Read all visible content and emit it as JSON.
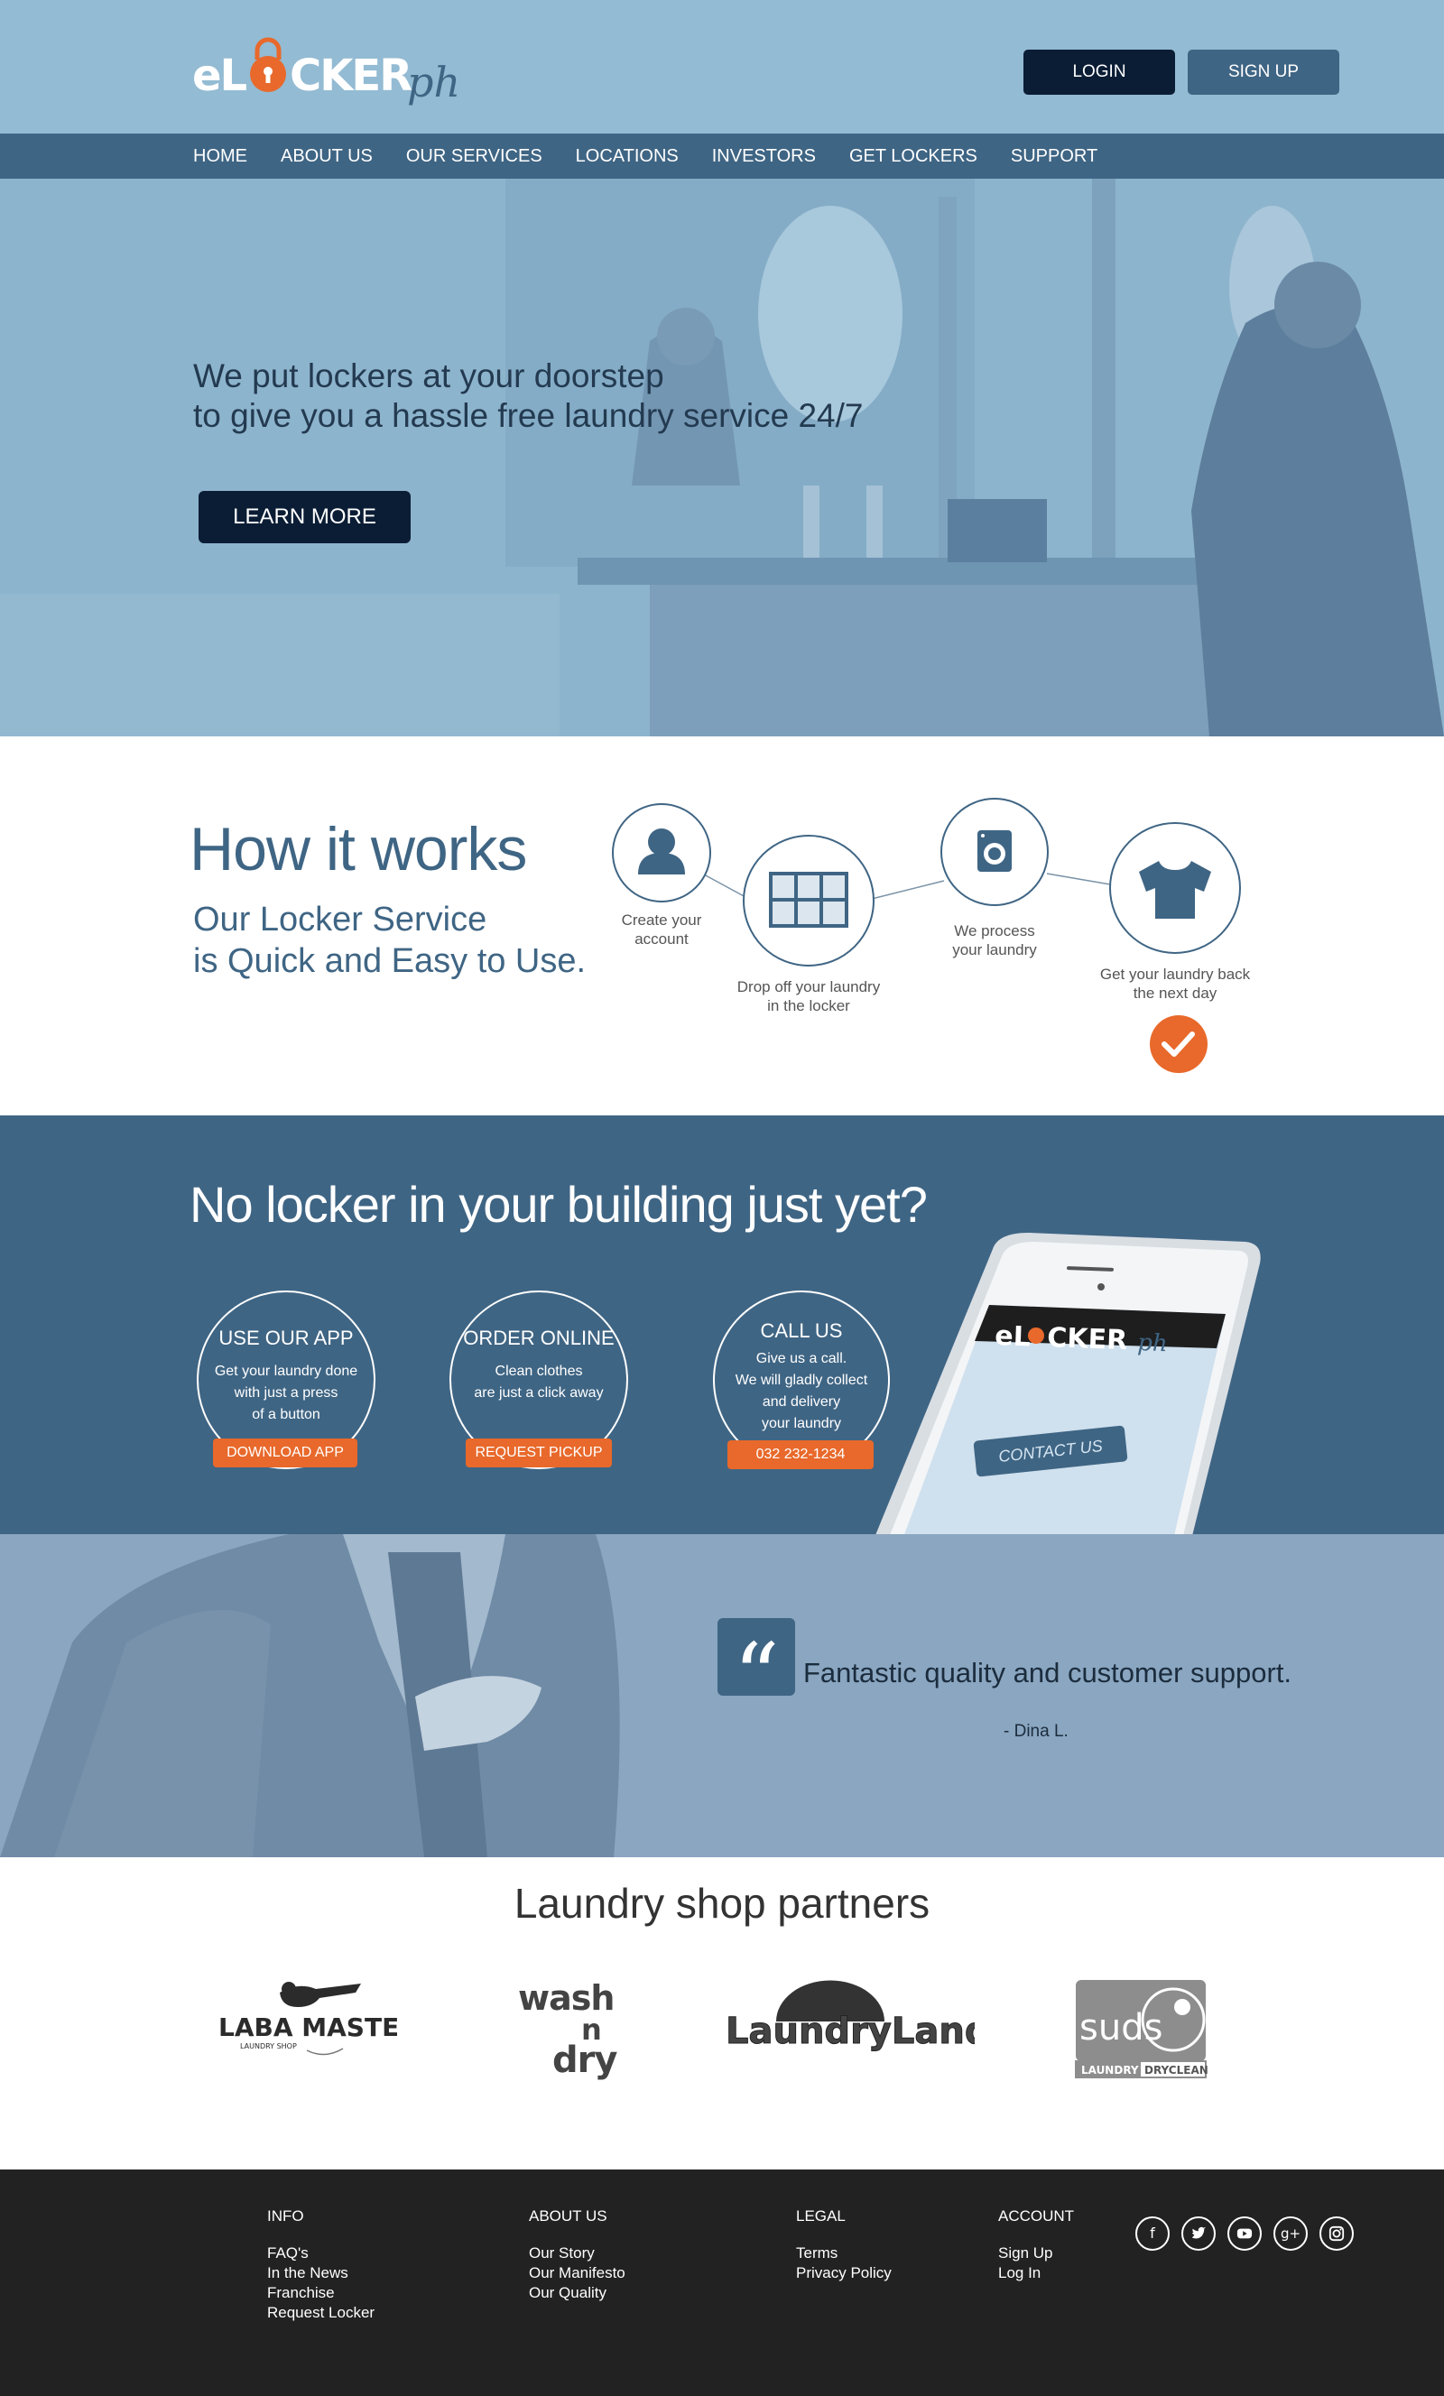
{
  "header": {
    "logo_prefix": "eL",
    "logo_suffix": "CKER",
    "logo_script": "ph",
    "login_label": "LOGIN",
    "signup_label": "SIGN UP"
  },
  "nav": {
    "items": [
      "HOME",
      "ABOUT US",
      "OUR SERVICES",
      "LOCATIONS",
      "INVESTORS",
      "GET LOCKERS",
      "SUPPORT"
    ]
  },
  "hero": {
    "line1": "We put lockers at your doorstep",
    "line2": "to give you a hassle free laundry service 24/7",
    "cta_label": "LEARN MORE"
  },
  "how": {
    "title": "How it works",
    "subtitle_line1": "Our Locker Service",
    "subtitle_line2": "is Quick and Easy to Use.",
    "steps": [
      {
        "icon": "user-icon",
        "line1": "Create your",
        "line2": "account"
      },
      {
        "icon": "locker-icon",
        "line1": "Drop off your laundry",
        "line2": "in the locker"
      },
      {
        "icon": "washing-machine-icon",
        "line1": "We process",
        "line2": "your laundry"
      },
      {
        "icon": "tshirt-icon",
        "line1": "Get your laundry back",
        "line2": "the next day"
      }
    ]
  },
  "nolocker": {
    "title": "No locker in your building just yet?",
    "options": [
      {
        "head": "USE OUR APP",
        "desc1": "Get your laundry done",
        "desc2": "with just a press",
        "desc3": "of a button",
        "button": "DOWNLOAD APP"
      },
      {
        "head": "ORDER ONLINE",
        "desc1": "Clean clothes",
        "desc2": "are just a click away",
        "desc3": "",
        "button": "REQUEST PICKUP"
      },
      {
        "head": "CALL US",
        "desc1": "Give us a call.",
        "desc2": "We will gladly collect",
        "desc3": "and delivery",
        "desc4": "your laundry",
        "button": "032 232-1234"
      }
    ],
    "phone_button": "CONTACT US"
  },
  "testimonial": {
    "quote": "Fantastic quality and customer support.",
    "author": "- Dina L."
  },
  "partners": {
    "title": "Laundry shop partners",
    "logos": [
      {
        "name": "LABA MASTERS",
        "tagline": "LAUNDRY SHOP"
      },
      {
        "name_line1": "wash",
        "name_line2": "n",
        "name_line3": "dry"
      },
      {
        "name": "LaundryLand"
      },
      {
        "name": "suds",
        "tag1": "LAUNDRY",
        "tag2": "DRYCLEAN"
      }
    ]
  },
  "footer": {
    "info": {
      "head": "INFO",
      "links": [
        "FAQ's",
        "In the News",
        "Franchise",
        "Request Locker"
      ]
    },
    "about": {
      "head": "ABOUT US",
      "links": [
        "Our Story",
        "Our Manifesto",
        "Our Quality"
      ]
    },
    "legal": {
      "head": "LEGAL",
      "links": [
        "Terms",
        "Privacy Policy"
      ]
    },
    "account": {
      "head": "ACCOUNT",
      "links": [
        "Sign Up",
        "Log In"
      ]
    },
    "social": [
      "facebook-icon",
      "twitter-icon",
      "youtube-icon",
      "google-plus-icon",
      "instagram-icon"
    ]
  },
  "colors": {
    "accent": "#e8692b",
    "brand_blue": "#3f6584",
    "dark_navy": "#0b1d35",
    "light_blue": "#93bbd3",
    "footer": "#222222"
  }
}
